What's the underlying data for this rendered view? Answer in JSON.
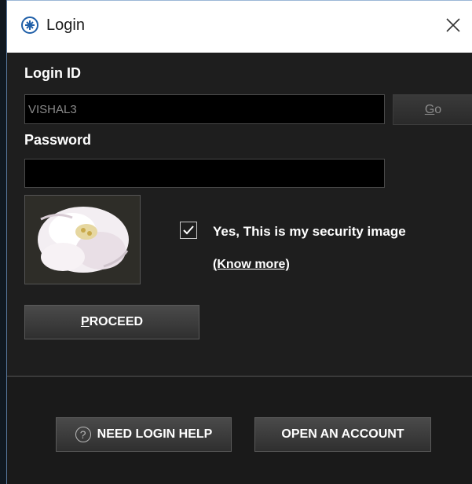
{
  "window": {
    "title": "Login",
    "icon": "app-logo-icon"
  },
  "form": {
    "login_id_label": "Login ID",
    "login_id_value": "VISHAL3",
    "go_label": "Go",
    "go_accesskey": "G",
    "password_label": "Password",
    "password_value": "",
    "security_image": "security-rose-image",
    "security_checked": true,
    "security_confirm_label": "Yes, This is my security image",
    "know_more_label": "(Know more)",
    "proceed_label": "ROCEED",
    "proceed_accesskey": "P"
  },
  "footer": {
    "help_label": "NEED LOGIN HELP",
    "open_account_label": "OPEN AN ACCOUNT"
  },
  "colors": {
    "background": "#1e1e1e",
    "titlebar": "#ffffff",
    "text": "#ffffff",
    "field_bg": "#000000"
  }
}
